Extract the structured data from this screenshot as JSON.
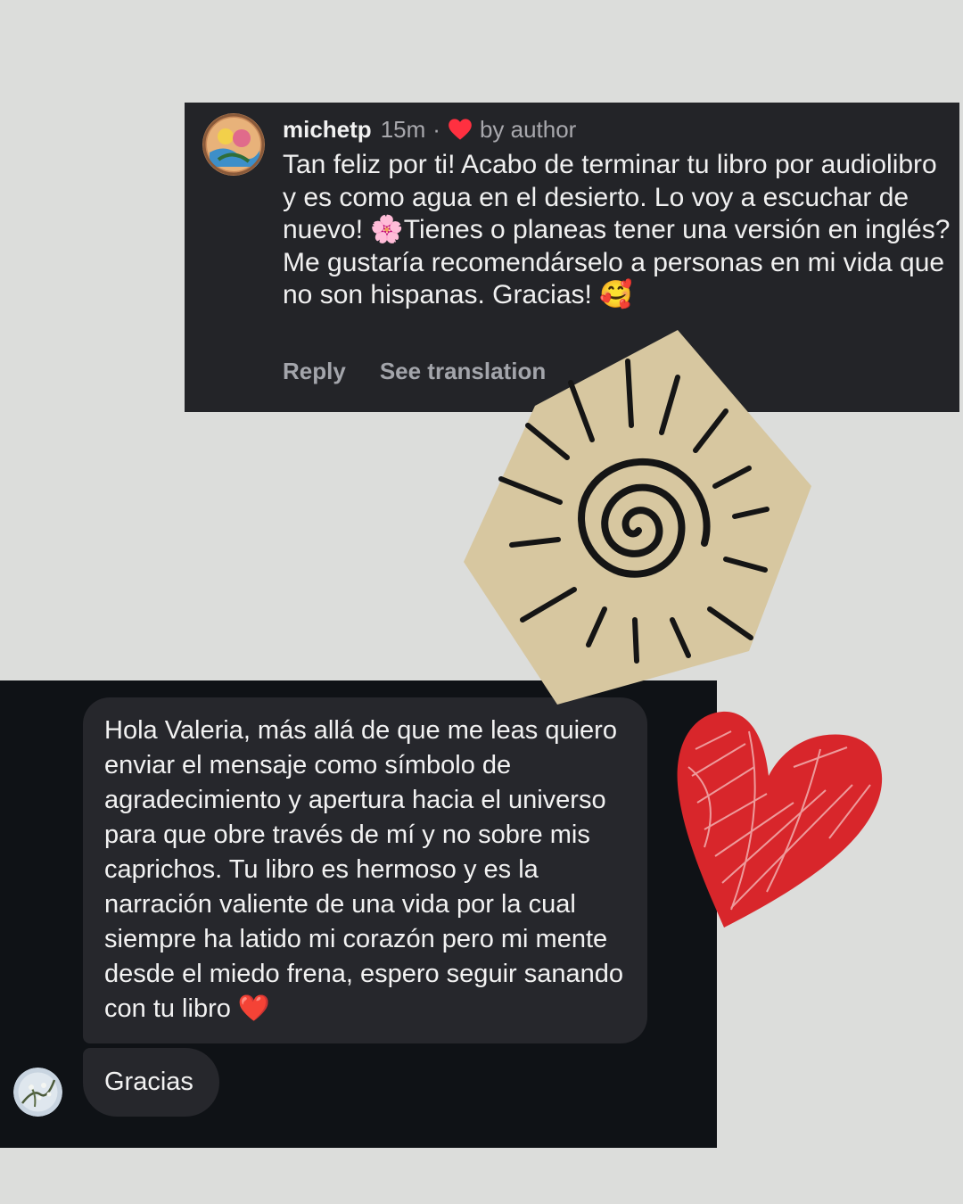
{
  "comment": {
    "username": "michetp",
    "time": "15m",
    "separator": "·",
    "liked_by": "by author",
    "text": "Tan feliz por ti! Acabo de terminar tu libro por audiolibro y es como agua en el desierto. Lo voy a escuchar de nuevo! 🌸Tienes o planeas tener una versión en inglés? Me gustaría recomendárselo a personas en mi vida que no son hispanas. Gracias! 🥰",
    "reply_label": "Reply",
    "translation_label": "See translation",
    "heart_color": "#ff3040"
  },
  "dm": {
    "messages": [
      {
        "text": "Hola Valeria, más allá de que me leas quiero enviar el mensaje como símbolo de agradecimiento y apertura hacia el universo para que obre través de mí y no sobre mis caprichos. Tu libro es hermoso y es la narración valiente de una vida por la cual siempre ha latido mi corazón pero mi mente desde el miedo frena, espero seguir sanando con tu libro ❤️"
      },
      {
        "text": "Gracias"
      }
    ]
  },
  "decor": {
    "sun_icon": "sun-spiral-sticker",
    "heart_icon": "scribble-heart-sticker",
    "sun_fill": "#d7c7a0",
    "heart_fill": "#d8262b"
  }
}
